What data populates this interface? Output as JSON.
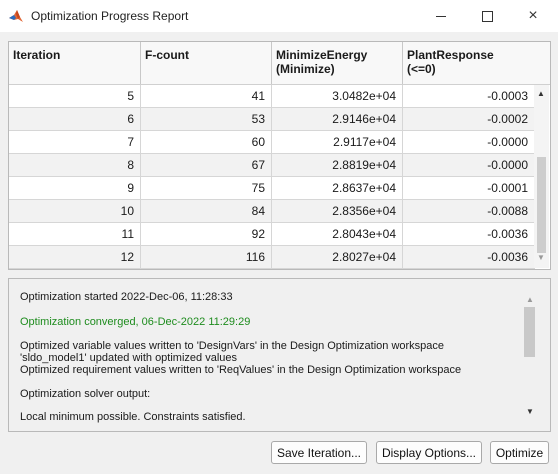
{
  "window": {
    "title": "Optimization Progress Report",
    "icon": "matlab-icon",
    "controls": {
      "minimize": "minimize-icon",
      "maximize": "maximize-icon",
      "close": "×"
    }
  },
  "table": {
    "headers": {
      "iteration": "Iteration",
      "fcount": "F-count",
      "energy_line1": "MinimizeEnergy",
      "energy_line2": "(Minimize)",
      "plant_line1": "PlantResponse",
      "plant_line2": "(<=0)"
    },
    "rows": [
      [
        "5",
        "41",
        "3.0482e+04",
        "-0.0003"
      ],
      [
        "6",
        "53",
        "2.9146e+04",
        "-0.0002"
      ],
      [
        "7",
        "60",
        "2.9117e+04",
        "-0.0000"
      ],
      [
        "8",
        "67",
        "2.8819e+04",
        "-0.0000"
      ],
      [
        "9",
        "75",
        "2.8637e+04",
        "-0.0001"
      ],
      [
        "10",
        "84",
        "2.8356e+04",
        "-0.0088"
      ],
      [
        "11",
        "92",
        "2.8043e+04",
        "-0.0036"
      ],
      [
        "12",
        "116",
        "2.8027e+04",
        "-0.0036"
      ]
    ],
    "scroll_up": "▲",
    "scroll_down": "▼"
  },
  "log": {
    "lines": [
      "Optimization started 2022-Dec-06, 11:28:33",
      "Optimization converged, 06-Dec-2022 11:29:29",
      "Optimized variable values written to 'DesignVars' in the Design Optimization workspace",
      "'sldo_model1' updated with optimized values",
      "Optimized requirement values written to 'ReqValues' in the Design Optimization workspace",
      "Optimization solver output:",
      "Local minimum possible. Constraints satisfied."
    ],
    "converged_color": "#1e8c1e",
    "scroll_up": "▲",
    "scroll_down": "▼"
  },
  "buttons": {
    "save_iteration": "Save Iteration...",
    "display_options": "Display Options...",
    "optimize": "Optimize"
  }
}
